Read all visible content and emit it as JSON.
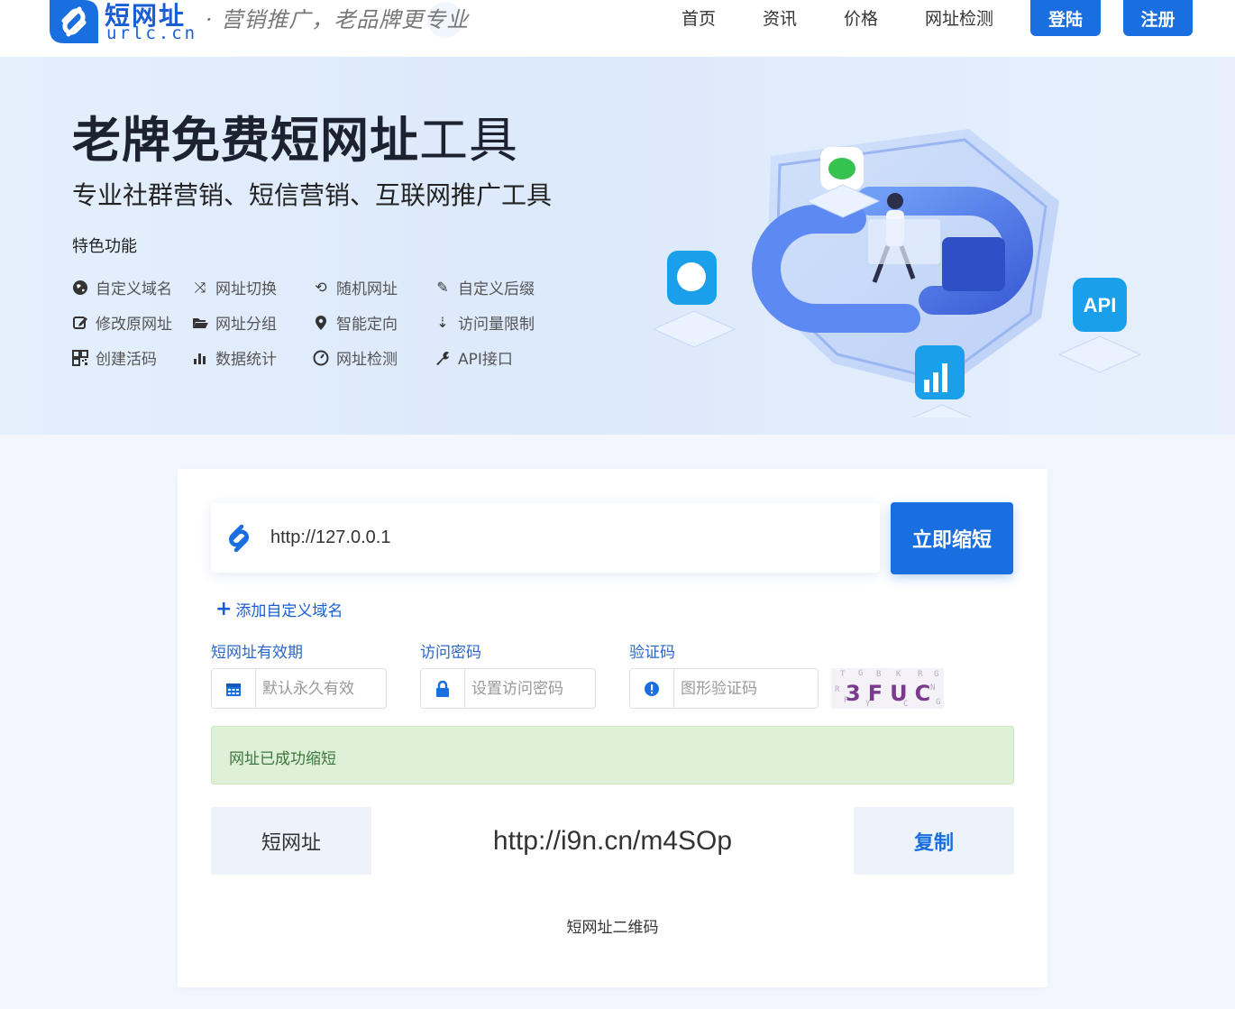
{
  "header": {
    "brand_cn": "短网址",
    "brand_en": "urlc.cn",
    "slogan": "· 营销推广，老品牌更专业",
    "nav": [
      {
        "label": "首页"
      },
      {
        "label": "资讯"
      },
      {
        "label": "价格"
      },
      {
        "label": "网址检测"
      }
    ],
    "login_label": "登陆",
    "register_label": "注册",
    "accent_color": "#1a6fe0"
  },
  "hero": {
    "title_bold": "老牌免费短网址",
    "title_light": "工具",
    "subtitle": "专业社群营销、短信营销、互联网推广工具",
    "features_label": "特色功能",
    "features": [
      {
        "label": "自定义域名",
        "icon": "globe-icon"
      },
      {
        "label": "网址切换",
        "icon": "shuffle-icon"
      },
      {
        "label": "随机网址",
        "icon": "retweet-icon"
      },
      {
        "label": "自定义后缀",
        "icon": "edit-underline-icon"
      },
      {
        "label": "修改原网址",
        "icon": "pencil-square-icon"
      },
      {
        "label": "网址分组",
        "icon": "folder-open-icon"
      },
      {
        "label": "智能定向",
        "icon": "map-marker-icon"
      },
      {
        "label": "访问量限制",
        "icon": "sort-numeric-icon"
      },
      {
        "label": "创建活码",
        "icon": "qrcode-icon"
      },
      {
        "label": "数据统计",
        "icon": "bar-chart-icon"
      },
      {
        "label": "网址检测",
        "icon": "dashboard-icon"
      },
      {
        "label": "API接口",
        "icon": "wrench-icon"
      }
    ]
  },
  "form": {
    "url_value": "http://127.0.0.1",
    "shorten_label": "立即缩短",
    "add_domain_label": "添加自定义域名",
    "validity_label": "短网址有效期",
    "validity_placeholder": "默认永久有效",
    "password_label": "访问密码",
    "password_placeholder": "设置访问密码",
    "captcha_label": "验证码",
    "captcha_placeholder": "图形验证码",
    "captcha_text": "3FUC"
  },
  "result": {
    "success_message": "网址已成功缩短",
    "short_label": "短网址",
    "short_url": "http://i9n.cn/m4SOp",
    "copy_label": "复制",
    "qr_label": "短网址二维码"
  }
}
